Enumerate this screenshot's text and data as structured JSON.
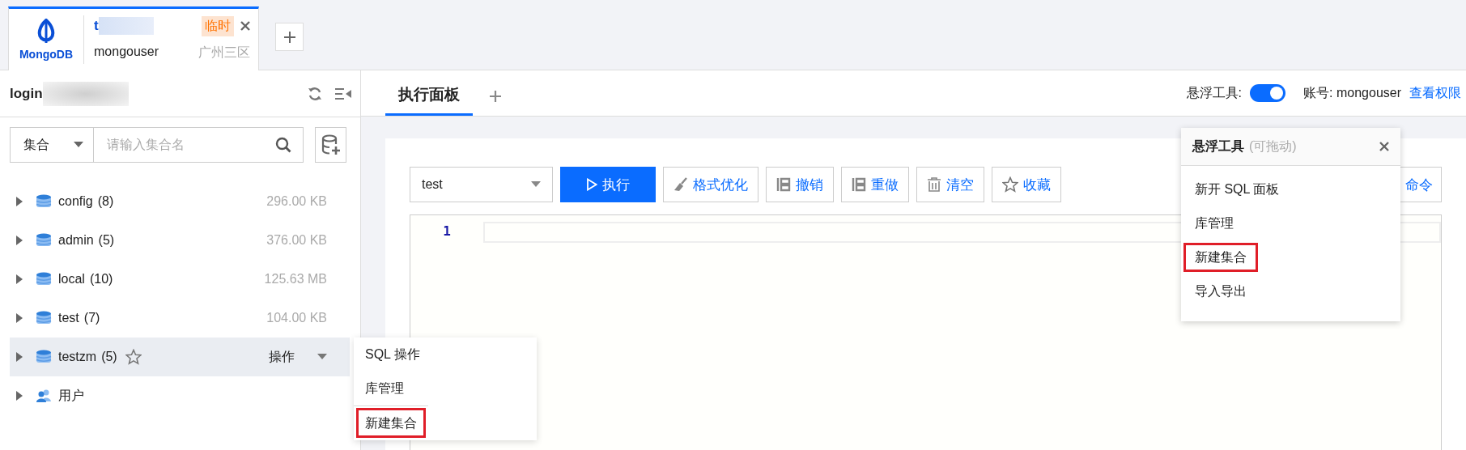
{
  "connection_tab": {
    "logo_label": "MongoDB",
    "name": "t",
    "badge": "临时",
    "user": "mongouser",
    "region": "广州三区",
    "selected": true
  },
  "sidebar": {
    "title": "login",
    "filter": {
      "type": "集合",
      "placeholder": "请输入集合名"
    },
    "tree": [
      {
        "kind": "database",
        "name": "config",
        "count": "(8)",
        "size": "296.00 KB",
        "selected": false
      },
      {
        "kind": "database",
        "name": "admin",
        "count": "(5)",
        "size": "376.00 KB",
        "selected": false
      },
      {
        "kind": "database",
        "name": "local",
        "count": "(10)",
        "size": "125.63 MB",
        "selected": false
      },
      {
        "kind": "database",
        "name": "test",
        "count": "(7)",
        "size": "104.00 KB",
        "selected": false
      },
      {
        "kind": "database",
        "name": "testzm",
        "count": "(5)",
        "action": "操作",
        "selected": true
      },
      {
        "kind": "users",
        "name": "用户",
        "selected": false
      }
    ],
    "row_menu": [
      {
        "label": "SQL 操作",
        "highlighted": false
      },
      {
        "label": "库管理",
        "highlighted": false
      },
      {
        "label": "新建集合",
        "highlighted": true
      }
    ]
  },
  "main": {
    "tabs": [
      {
        "label": "执行面板",
        "selected": true
      }
    ],
    "float_tool": {
      "label": "悬浮工具:",
      "on": true
    },
    "account": "账号: mongouser",
    "permissions_link": "查看权限",
    "toolbar": {
      "database": "test",
      "buttons": [
        {
          "kind": "primary",
          "label": "执行"
        },
        {
          "kind": "format",
          "label": "格式优化"
        },
        {
          "kind": "undo",
          "label": "撤销"
        },
        {
          "kind": "redo",
          "label": "重做"
        },
        {
          "kind": "clear",
          "label": "清空"
        },
        {
          "kind": "star",
          "label": "收藏"
        },
        {
          "kind": "plain",
          "label": "命令"
        }
      ]
    },
    "editor": {
      "line_numbers": [
        "1"
      ]
    }
  },
  "float_panel": {
    "title": "悬浮工具",
    "hint": "(可拖动)",
    "items": [
      {
        "label": "新开 SQL 面板",
        "highlighted": false
      },
      {
        "label": "库管理",
        "highlighted": false
      },
      {
        "label": "新建集合",
        "highlighted": true
      },
      {
        "label": "导入导出",
        "highlighted": false
      }
    ]
  }
}
